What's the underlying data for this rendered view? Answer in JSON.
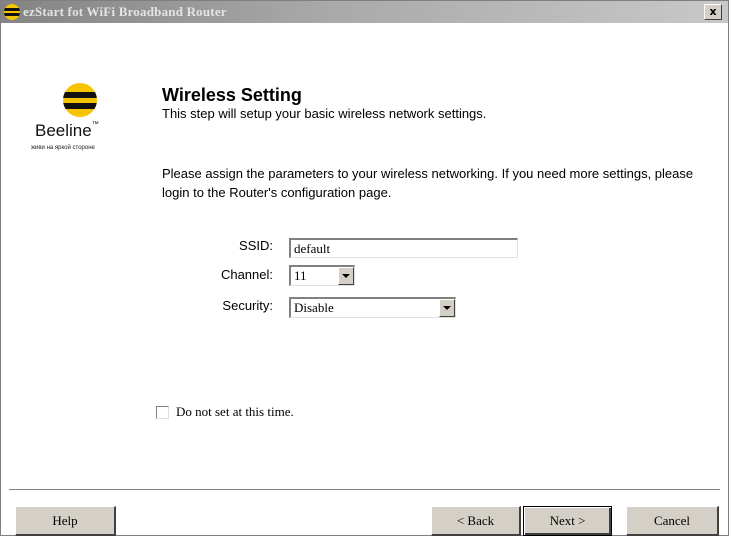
{
  "window": {
    "title": "ezStart fot WiFi Broadband Router",
    "close_label": "x"
  },
  "brand": {
    "name": "Beeline",
    "trademark": "™",
    "slogan": "живи на яркой стороне",
    "colors": {
      "yellow": "#f6c400",
      "black": "#111111"
    }
  },
  "page": {
    "title": "Wireless Setting",
    "subtitle": "This step will setup your basic wireless network settings.",
    "intro": "Please assign the parameters to your wireless networking. If you need more settings, please login to the Router's configuration page."
  },
  "form": {
    "ssid_label": "SSID:",
    "ssid_value": "default",
    "channel_label": "Channel:",
    "channel_value": "11",
    "security_label": "Security:",
    "security_value": "Disable",
    "skip_label": "Do not set at this time."
  },
  "buttons": {
    "help": "Help",
    "back": "< Back",
    "next": "Next >",
    "cancel": "Cancel"
  }
}
